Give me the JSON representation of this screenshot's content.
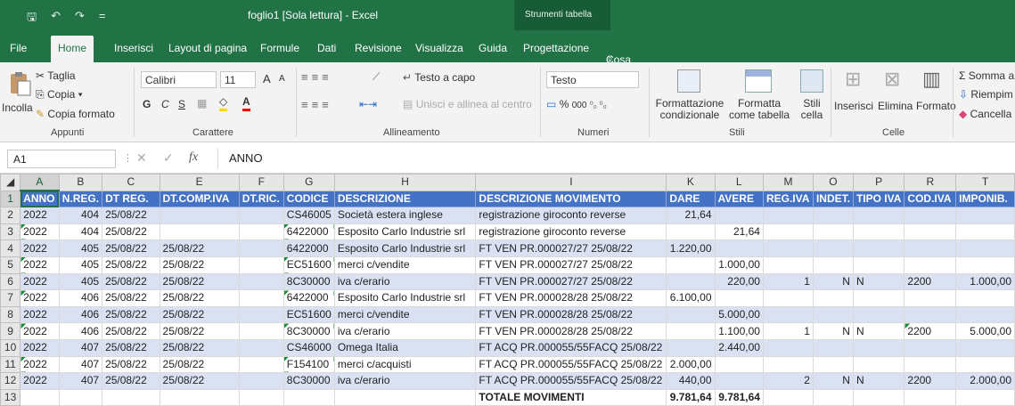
{
  "window": {
    "title": "foglio1  [Sola lettura]  -  Excel",
    "context_tab": "Strumenti tabella",
    "qat": {
      "save": "🖫",
      "undo": "↶",
      "redo": "↷",
      "more": "="
    }
  },
  "tabs": [
    "File",
    "Home",
    "Inserisci",
    "Layout di pagina",
    "Formule",
    "Dati",
    "Revisione",
    "Visualizza",
    "Guida",
    "Progettazione"
  ],
  "tell_me": "Cosa vuoi fare?",
  "ribbon": {
    "clipboard": {
      "paste": "Incolla",
      "cut": "Taglia",
      "copy": "Copia",
      "copy_arrow": "▾",
      "format_painter": "Copia formato",
      "group": "Appunti"
    },
    "font": {
      "name": "Calibri",
      "size": "11",
      "increase": "A",
      "decrease": "A",
      "bold": "G",
      "italic": "C",
      "underline": "S",
      "group": "Carattere"
    },
    "alignment": {
      "wrap": "Testo a capo",
      "merge": "Unisci e allinea al centro",
      "group": "Allineamento"
    },
    "number": {
      "format": "Testo",
      "percent": "%",
      "thousands": "000",
      "group": "Numeri"
    },
    "styles": {
      "conditional": "Formattazione condizionale",
      "table": "Formatta come tabella",
      "cell": "Stili cella",
      "group": "Stili"
    },
    "cells": {
      "insert": "Inserisci",
      "delete": "Elimina",
      "format": "Formato",
      "group": "Celle"
    },
    "editing": {
      "sum": "Somma a",
      "fill": "Riempim",
      "clear": "Cancella"
    }
  },
  "formula_bar": {
    "name_box": "A1",
    "fx": "fx",
    "value": "ANNO"
  },
  "columns": [
    "A",
    "B",
    "C",
    "E",
    "F",
    "G",
    "H",
    "I",
    "K",
    "L",
    "M",
    "O",
    "P",
    "R",
    "T"
  ],
  "rows": [
    [
      "ANNO",
      "N.REG.",
      "DT REG.",
      "DT.COMP.IVA",
      "DT.RIC.",
      "CODICE",
      "DESCRIZIONE",
      "DESCRIZIONE MOVIMENTO",
      "DARE",
      "AVERE",
      "REG.IVA",
      "INDET.",
      "TIPO IVA",
      "COD.IVA",
      "IMPONIB."
    ],
    [
      "2022",
      "404",
      "25/08/22",
      "",
      "",
      "CS46005",
      "Società estera  inglese",
      "registrazione giroconto reverse",
      "21,64",
      "",
      "",
      "",
      "",
      "",
      ""
    ],
    [
      "2022",
      "404",
      "25/08/22",
      "",
      "",
      "6422000",
      "Esposito Carlo Industrie srl",
      "registrazione giroconto reverse",
      "",
      "21,64",
      "",
      "",
      "",
      "",
      ""
    ],
    [
      "2022",
      "405",
      "25/08/22",
      "25/08/22",
      "",
      "6422000",
      "Esposito Carlo Industrie srl",
      "FT VEN PR.000027/27 25/08/22",
      "1.220,00",
      "",
      "",
      "",
      "",
      "",
      ""
    ],
    [
      "2022",
      "405",
      "25/08/22",
      "25/08/22",
      "",
      "EC51600",
      "merci c/vendite",
      "FT VEN PR.000027/27 25/08/22",
      "",
      "1.000,00",
      "",
      "",
      "",
      "",
      ""
    ],
    [
      "2022",
      "405",
      "25/08/22",
      "25/08/22",
      "",
      "8C30000",
      "iva c/erario",
      "FT VEN PR.000027/27 25/08/22",
      "",
      "220,00",
      "1",
      "N",
      "N",
      "2200",
      "1.000,00"
    ],
    [
      "2022",
      "406",
      "25/08/22",
      "25/08/22",
      "",
      "6422000",
      "Esposito Carlo Industrie srl",
      "FT VEN PR.000028/28 25/08/22",
      "6.100,00",
      "",
      "",
      "",
      "",
      "",
      ""
    ],
    [
      "2022",
      "406",
      "25/08/22",
      "25/08/22",
      "",
      "EC51600",
      "merci c/vendite",
      "FT VEN PR.000028/28 25/08/22",
      "",
      "5.000,00",
      "",
      "",
      "",
      "",
      ""
    ],
    [
      "2022",
      "406",
      "25/08/22",
      "25/08/22",
      "",
      "8C30000",
      "iva c/erario",
      "FT VEN PR.000028/28 25/08/22",
      "",
      "1.100,00",
      "1",
      "N",
      "N",
      "2200",
      "5.000,00"
    ],
    [
      "2022",
      "407",
      "25/08/22",
      "25/08/22",
      "",
      "CS46000",
      "Omega Italia",
      "FT ACQ PR.000055/55FACQ 25/08/22",
      "",
      "2.440,00",
      "",
      "",
      "",
      "",
      ""
    ],
    [
      "2022",
      "407",
      "25/08/22",
      "25/08/22",
      "",
      "F154100",
      "merci c/acquisti",
      "FT ACQ PR.000055/55FACQ 25/08/22",
      "2.000,00",
      "",
      "",
      "",
      "",
      "",
      ""
    ],
    [
      "2022",
      "407",
      "25/08/22",
      "25/08/22",
      "",
      "8C30000",
      "iva c/erario",
      "FT ACQ PR.000055/55FACQ 25/08/22",
      "440,00",
      "",
      "2",
      "N",
      "N",
      "2200",
      "2.000,00"
    ],
    [
      "",
      "",
      "",
      "",
      "",
      "",
      "",
      "TOTALE MOVIMENTI",
      "9.781,64",
      "9.781,64",
      "",
      "",
      "",
      "",
      ""
    ]
  ]
}
